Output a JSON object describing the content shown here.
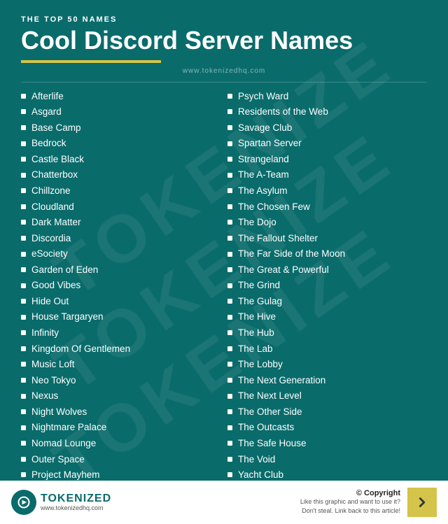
{
  "header": {
    "subtitle": "THE TOP 50 NAMES",
    "title": "Cool Discord Server Names",
    "underline": true,
    "domain_top": "www.tokenizedhq.com"
  },
  "left_column": [
    "Afterlife",
    "Asgard",
    "Base Camp",
    "Bedrock",
    "Castle Black",
    "Chatterbox",
    "Chillzone",
    "Cloudland",
    "Dark Matter",
    "Discordia",
    "eSociety",
    "Garden of Eden",
    "Good Vibes",
    "Hide Out",
    "House Targaryen",
    "Infinity",
    "Kingdom Of Gentlemen",
    "Music Loft",
    "Neo Tokyo",
    "Nexus",
    "Night Wolves",
    "Nightmare Palace",
    "Nomad Lounge",
    "Outer Space",
    "Project Mayhem"
  ],
  "right_column": [
    "Psych Ward",
    "Residents of the Web",
    "Savage Club",
    "Spartan Server",
    "Strangeland",
    "The A-Team",
    "The Asylum",
    "The Chosen Few",
    "The Dojo",
    "The Fallout Shelter",
    "The Far Side of the Moon",
    "The Great & Powerful",
    "The Grind",
    "The Gulag",
    "The Hive",
    "The Hub",
    "The Lab",
    "The Lobby",
    "The Next Generation",
    "The Next Level",
    "The Other Side",
    "The Outcasts",
    "The Safe House",
    "The Void",
    "Yacht Club"
  ],
  "footer": {
    "logo_brand": "TOKENIZED",
    "logo_domain": "www.tokenizedhq.com",
    "copyright_label": "© Copyright",
    "copyright_sub1": "Like this graphic and want to use it?",
    "copyright_sub2": "Don't steal. Link back to this article!"
  },
  "watermark": "TOKENIZE"
}
